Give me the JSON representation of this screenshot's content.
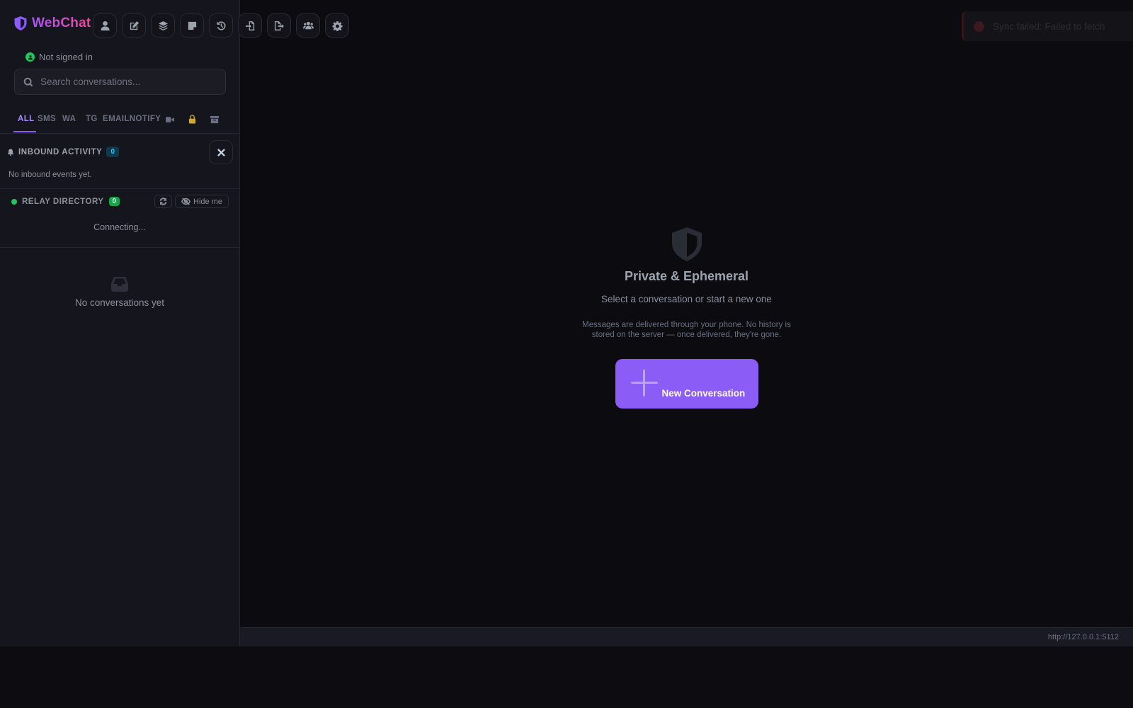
{
  "brand": {
    "name": "WebChat"
  },
  "toolbar": {
    "buttons": [
      {
        "icon": "user-icon"
      },
      {
        "icon": "edit-icon"
      },
      {
        "icon": "layers-icon"
      },
      {
        "icon": "note-icon"
      },
      {
        "icon": "history-icon"
      },
      {
        "icon": "import-icon"
      },
      {
        "icon": "export-icon"
      },
      {
        "icon": "users-icon"
      },
      {
        "icon": "gear-icon"
      }
    ]
  },
  "account": {
    "status": "Not signed in"
  },
  "search": {
    "placeholder": "Search conversations...",
    "value": ""
  },
  "tabs": {
    "all": "ALL",
    "sms": "SMS",
    "wa": "WA",
    "tg": "TG",
    "emailnotify": "EMAILNOTIFY",
    "icons": [
      "video-icon",
      "lock-icon",
      "archive-icon"
    ]
  },
  "inbound": {
    "title": "INBOUND ACTIVITY",
    "count": "0",
    "empty": "No inbound events yet."
  },
  "relay": {
    "title": "RELAY DIRECTORY",
    "count": "0",
    "hide_label": "Hide me",
    "status": "Connecting..."
  },
  "conversations": {
    "empty": "No conversations yet"
  },
  "toast": {
    "message": "Sync failed: Failed to fetch"
  },
  "main": {
    "title": "Private & Ephemeral",
    "subtitle": "Select a conversation or start a new one",
    "note": "Messages are delivered through your phone. No history is stored on the server — once delivered, they're gone.",
    "new_button": "New Conversation"
  },
  "statusbar": {
    "url": "http://127.0.0.1:5112"
  },
  "colors": {
    "accent": "#8b5cf6",
    "success": "#22c55e",
    "info": "#38bdf8"
  }
}
